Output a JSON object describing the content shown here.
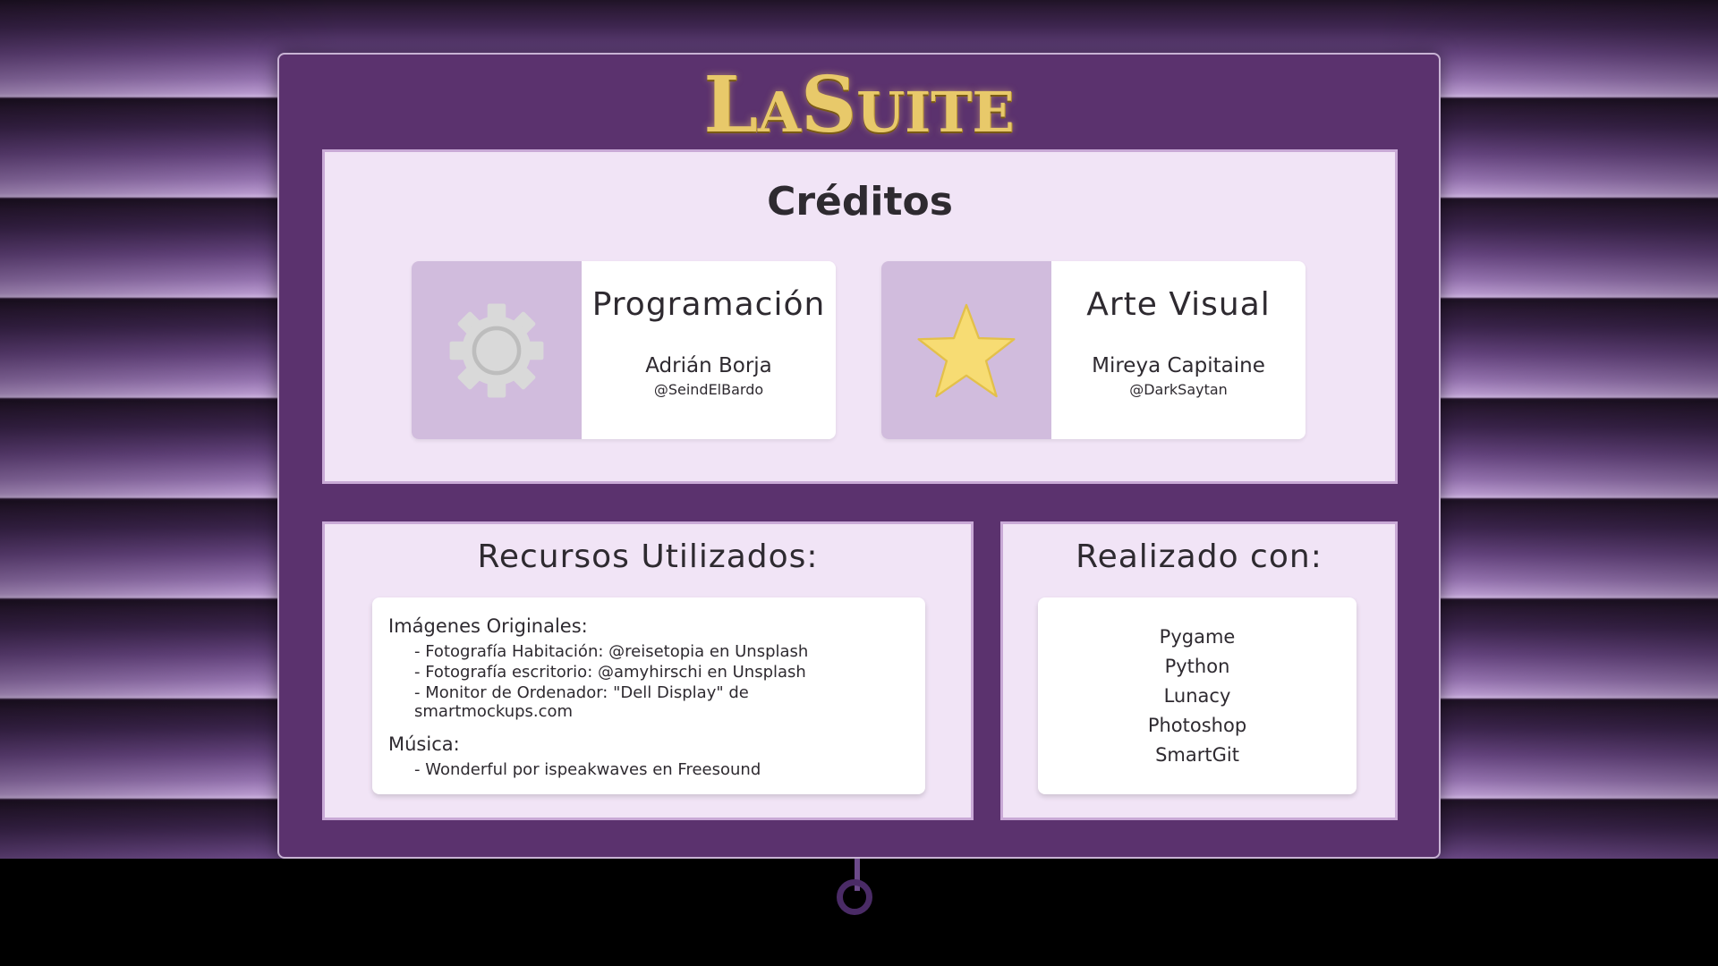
{
  "logo": {
    "text_big_1": "L",
    "text_small_1": "A",
    "text_big_2": "S",
    "text_small_2": "UITE"
  },
  "creditos": {
    "title": "Créditos",
    "cards": [
      {
        "role": "Programación",
        "person": "Adrián Borja",
        "handle": "@SeindElBardo",
        "icon": "gear-icon"
      },
      {
        "role": "Arte Visual",
        "person": "Mireya Capitaine",
        "handle": "@DarkSaytan",
        "icon": "star-icon"
      }
    ]
  },
  "recursos": {
    "title": "Recursos Utilizados:",
    "imagenes_heading": "Imágenes Originales:",
    "imagenes": [
      "- Fotografía Habitación: @reisetopia en Unsplash",
      "- Fotografía escritorio: @amyhirschi en Unsplash",
      "- Monitor de Ordenador: \"Dell Display\" de smartmockups.com"
    ],
    "musica_heading": "Música:",
    "musica": [
      "- Wonderful por ispeakwaves en Freesound"
    ]
  },
  "realizado": {
    "title": "Realizado con:",
    "tools": [
      "Pygame",
      "Python",
      "Lunacy",
      "Photoshop",
      "SmartGit"
    ]
  },
  "colors": {
    "panel": "#5b326e",
    "box_bg": "#f1e4f6",
    "icon_bg": "#d1bcdd",
    "gold": "#e8c96a",
    "star": "#f7dc73",
    "gear": "#d9d9d9"
  }
}
